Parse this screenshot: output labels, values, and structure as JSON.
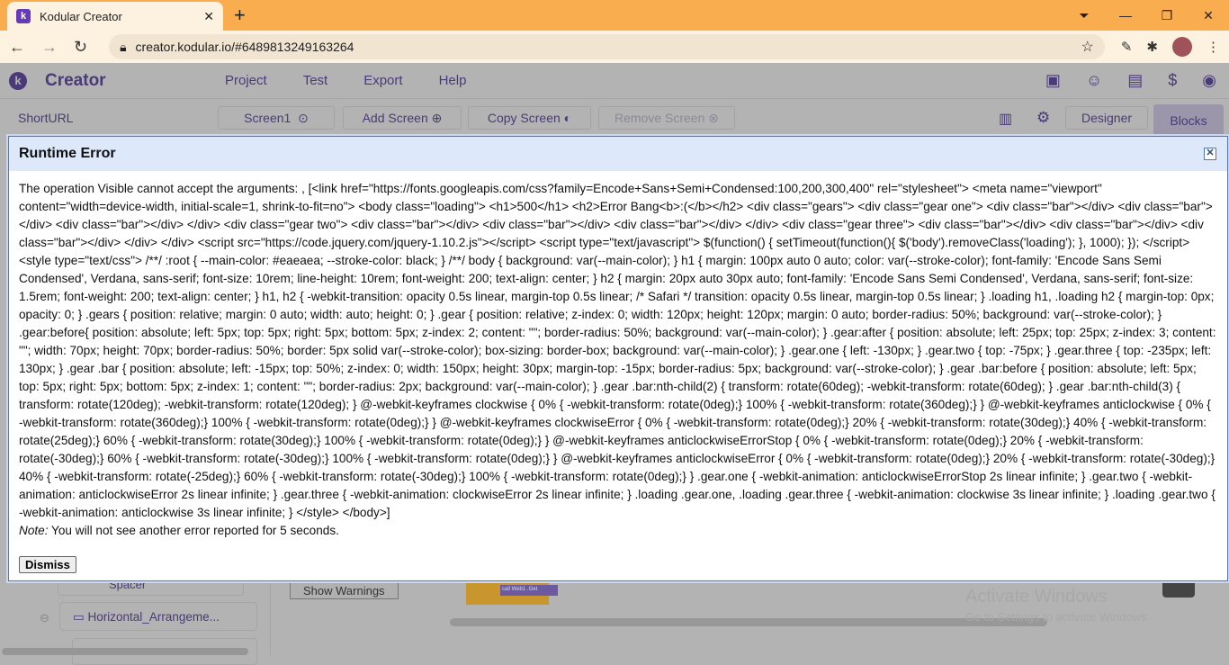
{
  "browser": {
    "tab_title": "Kodular Creator",
    "url": "creator.kodular.io/#6489813249163264"
  },
  "app": {
    "brand": "Creator",
    "menu": [
      "Project",
      "Test",
      "Export",
      "Help"
    ],
    "project_name": "ShortURL",
    "screen_select": "Screen1",
    "add_screen": "Add Screen",
    "copy_screen": "Copy Screen",
    "remove_screen": "Remove Screen",
    "designer": "Designer",
    "blocks": "Blocks"
  },
  "background": {
    "spacer_item": "Spacer",
    "arrangement_item": "Horizontal_Arrangeme...",
    "show_warnings": "Show Warnings",
    "block_label": "call Web1 .Get",
    "watermark_title": "Activate Windows",
    "watermark_sub": "Go to Settings to activate Windows."
  },
  "dialog": {
    "title": "Runtime Error",
    "message": "The operation Visible cannot accept the arguments: , [<link href=\"https://fonts.googleapis.com/css?family=Encode+Sans+Semi+Condensed:100,200,300,400\" rel=\"stylesheet\"> <meta name=\"viewport\" content=\"width=device-width, initial-scale=1, shrink-to-fit=no\"> <body class=\"loading\"> <h1>500</h1> <h2>Error Bang<b>:(</b></h2> <div class=\"gears\"> <div class=\"gear one\"> <div class=\"bar\"></div> <div class=\"bar\"></div> <div class=\"bar\"></div> </div> <div class=\"gear two\"> <div class=\"bar\"></div> <div class=\"bar\"></div> <div class=\"bar\"></div> </div> <div class=\"gear three\"> <div class=\"bar\"></div> <div class=\"bar\"></div> <div class=\"bar\"></div> </div> </div> <script src=\"https://code.jquery.com/jquery-1.10.2.js\"></script> <script type=\"text/javascript\"> $(function() { setTimeout(function(){ $('body').removeClass('loading'); }, 1000); }); </script> <style type=\"text/css\"> /**/ :root { --main-color: #eaeaea; --stroke-color: black; } /**/ body { background: var(--main-color); } h1 { margin: 100px auto 0 auto; color: var(--stroke-color); font-family: 'Encode Sans Semi Condensed', Verdana, sans-serif; font-size: 10rem; line-height: 10rem; font-weight: 200; text-align: center; } h2 { margin: 20px auto 30px auto; font-family: 'Encode Sans Semi Condensed', Verdana, sans-serif; font-size: 1.5rem; font-weight: 200; text-align: center; } h1, h2 { -webkit-transition: opacity 0.5s linear, margin-top 0.5s linear; /* Safari */ transition: opacity 0.5s linear, margin-top 0.5s linear; } .loading h1, .loading h2 { margin-top: 0px; opacity: 0; } .gears { position: relative; margin: 0 auto; width: auto; height: 0; } .gear { position: relative; z-index: 0; width: 120px; height: 120px; margin: 0 auto; border-radius: 50%; background: var(--stroke-color); } .gear:before{ position: absolute; left: 5px; top: 5px; right: 5px; bottom: 5px; z-index: 2; content: \"\"; border-radius: 50%; background: var(--main-color); } .gear:after { position: absolute; left: 25px; top: 25px; z-index: 3; content: \"\"; width: 70px; height: 70px; border-radius: 50%; border: 5px solid var(--stroke-color); box-sizing: border-box; background: var(--main-color); } .gear.one { left: -130px; } .gear.two { top: -75px; } .gear.three { top: -235px; left: 130px; } .gear .bar { position: absolute; left: -15px; top: 50%; z-index: 0; width: 150px; height: 30px; margin-top: -15px; border-radius: 5px; background: var(--stroke-color); } .gear .bar:before { position: absolute; left: 5px; top: 5px; right: 5px; bottom: 5px; z-index: 1; content: \"\"; border-radius: 2px; background: var(--main-color); } .gear .bar:nth-child(2) { transform: rotate(60deg); -webkit-transform: rotate(60deg); } .gear .bar:nth-child(3) { transform: rotate(120deg); -webkit-transform: rotate(120deg); } @-webkit-keyframes clockwise { 0% { -webkit-transform: rotate(0deg);} 100% { -webkit-transform: rotate(360deg);} } @-webkit-keyframes anticlockwise { 0% { -webkit-transform: rotate(360deg);} 100% { -webkit-transform: rotate(0deg);} } @-webkit-keyframes clockwiseError { 0% { -webkit-transform: rotate(0deg);} 20% { -webkit-transform: rotate(30deg);} 40% { -webkit-transform: rotate(25deg);} 60% { -webkit-transform: rotate(30deg);} 100% { -webkit-transform: rotate(0deg);} } @-webkit-keyframes anticlockwiseErrorStop { 0% { -webkit-transform: rotate(0deg);} 20% { -webkit-transform: rotate(-30deg);} 60% { -webkit-transform: rotate(-30deg);} 100% { -webkit-transform: rotate(0deg);} } @-webkit-keyframes anticlockwiseError { 0% { -webkit-transform: rotate(0deg);} 20% { -webkit-transform: rotate(-30deg);} 40% { -webkit-transform: rotate(-25deg);} 60% { -webkit-transform: rotate(-30deg);} 100% { -webkit-transform: rotate(0deg);} } .gear.one { -webkit-animation: anticlockwiseErrorStop 2s linear infinite; } .gear.two { -webkit-animation: anticlockwiseError 2s linear infinite; } .gear.three { -webkit-animation: clockwiseError 2s linear infinite; } .loading .gear.one, .loading .gear.three { -webkit-animation: clockwise 3s linear infinite; } .loading .gear.two { -webkit-animation: anticlockwise 3s linear infinite; } </style> </body>]",
    "note_label": "Note:",
    "note_text": " You will not see another error reported for 5 seconds.",
    "dismiss": "Dismiss"
  }
}
